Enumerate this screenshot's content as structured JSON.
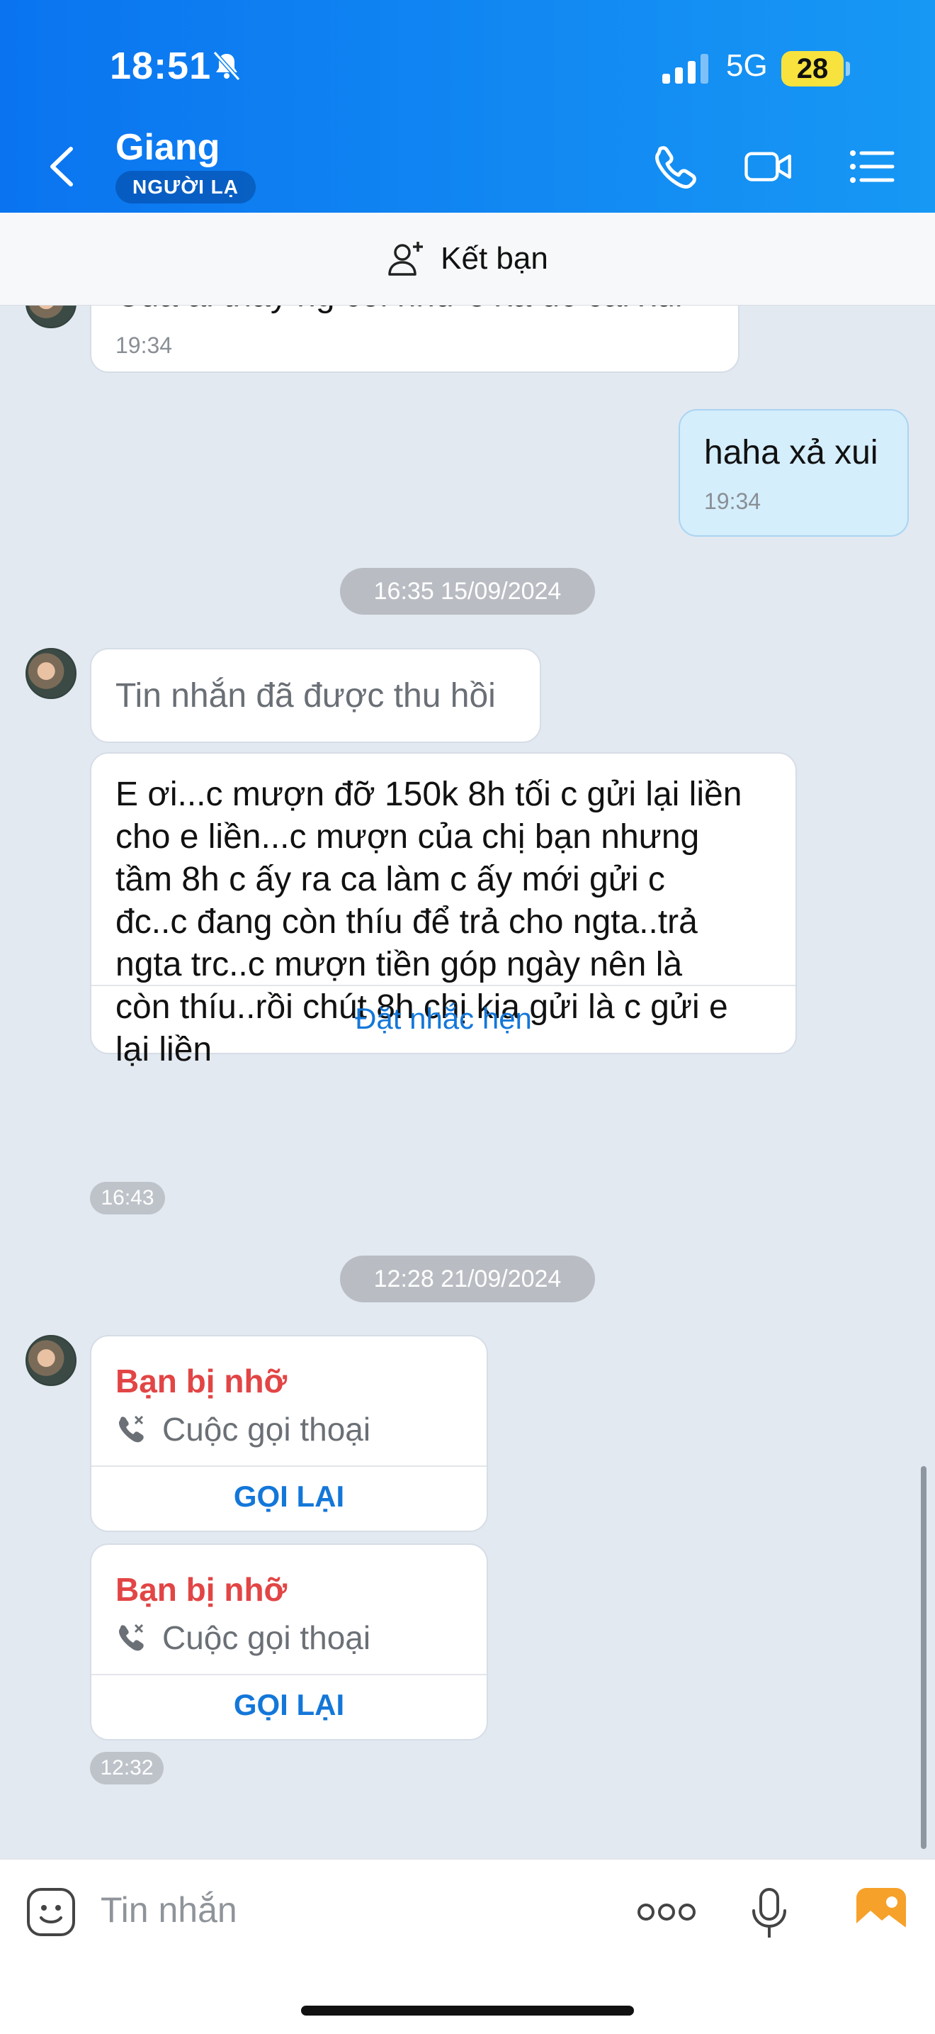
{
  "status_bar": {
    "time": "18:51",
    "network": "5G",
    "battery": "28"
  },
  "header": {
    "title": "Giang",
    "badge": "NGƯỜI LẠ"
  },
  "friend_bar": {
    "label": "Kết bạn"
  },
  "messages": {
    "partial_in": {
      "text": "Của ai thấy ng coi như e xả đc cái xui",
      "time": "19:34"
    },
    "out_1": {
      "text": "haha xả xui",
      "time": "19:34"
    },
    "date_1": "16:35 15/09/2024",
    "recalled": "Tin nhắn đã được thu hồi",
    "long_msg": {
      "lines": [
        "E ơi...c mượn đỡ 150k 8h tối c gửi lại liền",
        "cho e liền...c mượn của chị bạn nhưng",
        "tầm 8h c ấy ra ca làm c ấy mới gửi c",
        "đc..c đang còn thíu để trả cho ngta..trả",
        "ngta trc..c mượn tiền góp ngày nên là",
        "còn thíu..rồi chút 8h chị kia gửi là c gửi e",
        "lại liền"
      ],
      "action": "Đặt nhắc hẹn"
    },
    "time_1": "16:43",
    "date_2": "12:28 21/09/2024",
    "missed_calls": [
      {
        "title": "Bạn bị nhỡ",
        "subtitle": "Cuộc gọi thoại",
        "action": "GỌI LẠI"
      },
      {
        "title": "Bạn bị nhỡ",
        "subtitle": "Cuộc gọi thoại",
        "action": "GỌI LẠI"
      }
    ],
    "time_2": "12:32"
  },
  "composer": {
    "placeholder": "Tin nhắn"
  },
  "colors": {
    "header_start": "#0a74f0",
    "header_end": "#1798f4",
    "link": "#1377d9",
    "missed": "#e24545",
    "outgoing_bubble": "#d5eefc"
  }
}
